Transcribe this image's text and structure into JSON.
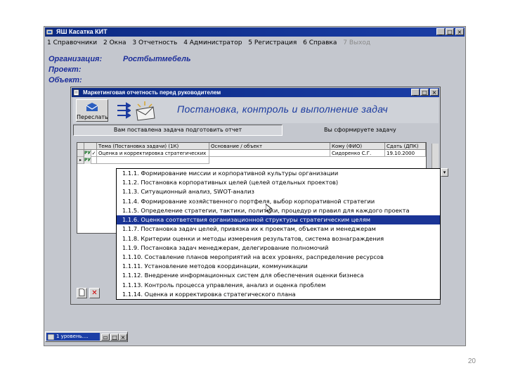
{
  "page_number": "20",
  "app": {
    "title": "ЯШ Касатка КИТ",
    "window_buttons": [
      "_",
      "□",
      "×"
    ],
    "menu": [
      {
        "label": "1 Справочники",
        "disabled": false
      },
      {
        "label": "2 Окна",
        "disabled": false
      },
      {
        "label": "3 Отчетность",
        "disabled": false
      },
      {
        "label": "4 Администратор",
        "disabled": false
      },
      {
        "label": "5 Регистрация",
        "disabled": false
      },
      {
        "label": "6 Справка",
        "disabled": false
      },
      {
        "label": "7 Выход",
        "disabled": true
      }
    ],
    "org_label": "Организация:",
    "org_value": "Ростбытмебель",
    "project_label": "Проект:",
    "object_label": "Объект:"
  },
  "inner": {
    "title": "Маркетинговая отчетность перед руководителем",
    "window_buttons": [
      "_",
      "□",
      "×"
    ],
    "send_label": "Переслать",
    "banner_title": "Постановка, контроль и выполнение задач",
    "left_label": "Вам поставлена задача подготовить отчет",
    "right_label": "Вы сформируете задачу",
    "table": {
      "columns": [
        "",
        "Тема (Постановка задачи) (1К)",
        "Основание / объект",
        "Кому (ФИО)",
        "Сдать (ДПК)"
      ],
      "rows": [
        {
          "tag": "РУ",
          "check": "✓",
          "topic": "Оценка и корректировка стратегических",
          "basis": "",
          "who": "Сидоренко С.Г.",
          "due": "19.10.2000"
        },
        {
          "tag": "РУ",
          "check": "",
          "topic": "",
          "basis": "",
          "who": "",
          "due": ""
        }
      ]
    },
    "toolbar": [
      "new",
      "delete"
    ]
  },
  "dropdown": {
    "selected_index": 5,
    "items": [
      "1.1.1. Формирование миссии и корпоративной культуры организации",
      "1.1.2. Постановка корпоративных целей (целей отдельных проектов)",
      "1.1.3. Ситуационный анализ, SWOT-анализ",
      "1.1.4. Формирование хозяйственного портфеля, выбор корпоративной стратегии",
      "1.1.5. Определение стратегии, тактики, политики, процедур и правил для каждого проекта",
      "1.1.6. Оценка соответствия организационной структуры стратегическим целям",
      "1.1.7. Постановка задач целей, привязка их к проектам, объектам и менеджерам",
      "1.1.8. Критерии оценки и методы измерения результатов, система вознаграждения",
      "1.1.9. Постановка задач менеджерам, делегирование полномочий",
      "1.1.10. Составление планов мероприятий на всех уровнях, распределение ресурсов",
      "1.1.11. Установление методов координации, коммуникации",
      "1.1.12. Внедрение информационных систем для обеспечения оценки бизнеса",
      "1.1.13. Контроль процесса управления, анализ и оценка проблем",
      "1.1.14. Оценка и корректировка стратегического плана"
    ]
  },
  "minimized": {
    "title": "1 уровень....",
    "buttons": [
      "▭",
      "□",
      "×"
    ]
  }
}
